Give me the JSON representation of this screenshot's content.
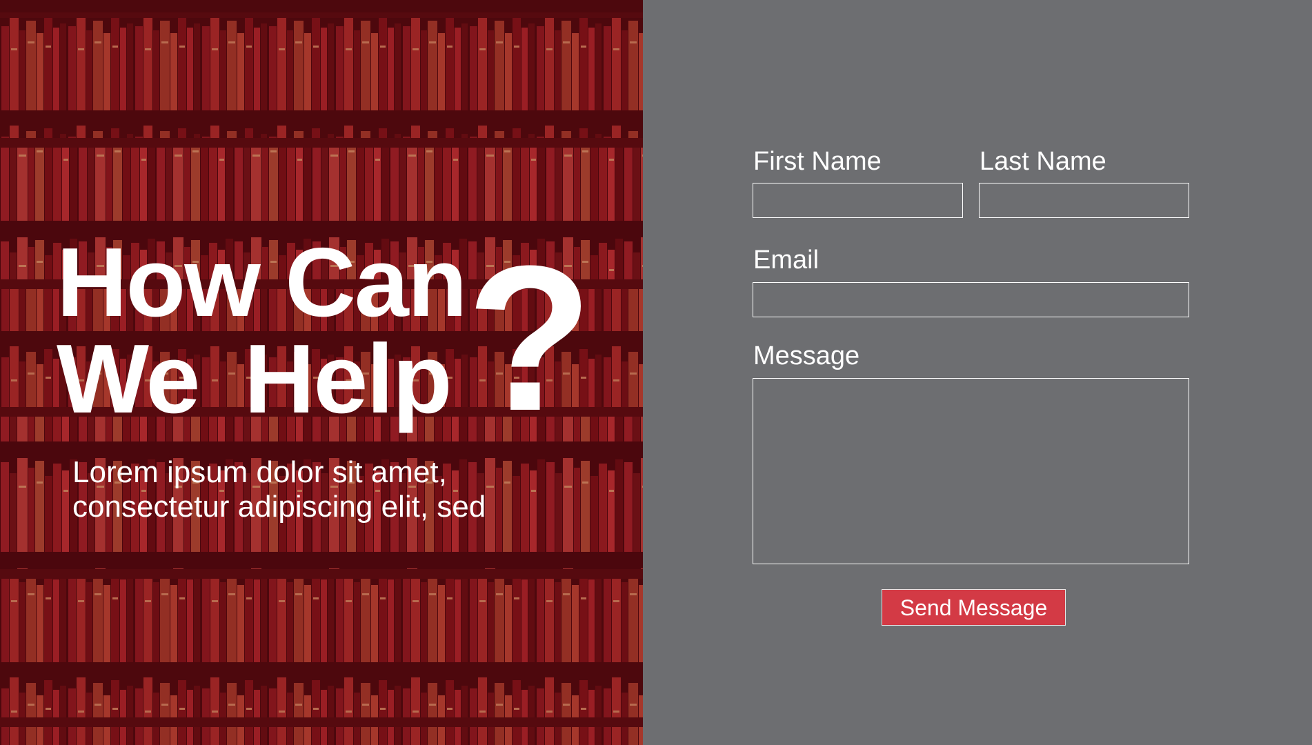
{
  "hero": {
    "heading_line1": "How Can",
    "heading_line2": "We  Help",
    "question_mark": "?",
    "subtitle_line1": "Lorem ipsum dolor sit amet,",
    "subtitle_line2": "consectetur adipiscing elit, sed",
    "background": "bookshelf-photo",
    "tint_color": "#7a0f16"
  },
  "form": {
    "first_name_label": "First Name",
    "first_name_value": "",
    "last_name_label": "Last Name",
    "last_name_value": "",
    "email_label": "Email",
    "email_value": "",
    "message_label": "Message",
    "message_value": "",
    "submit_label": "Send Message",
    "panel_color": "#6d6e71",
    "button_color": "#d33a45"
  }
}
